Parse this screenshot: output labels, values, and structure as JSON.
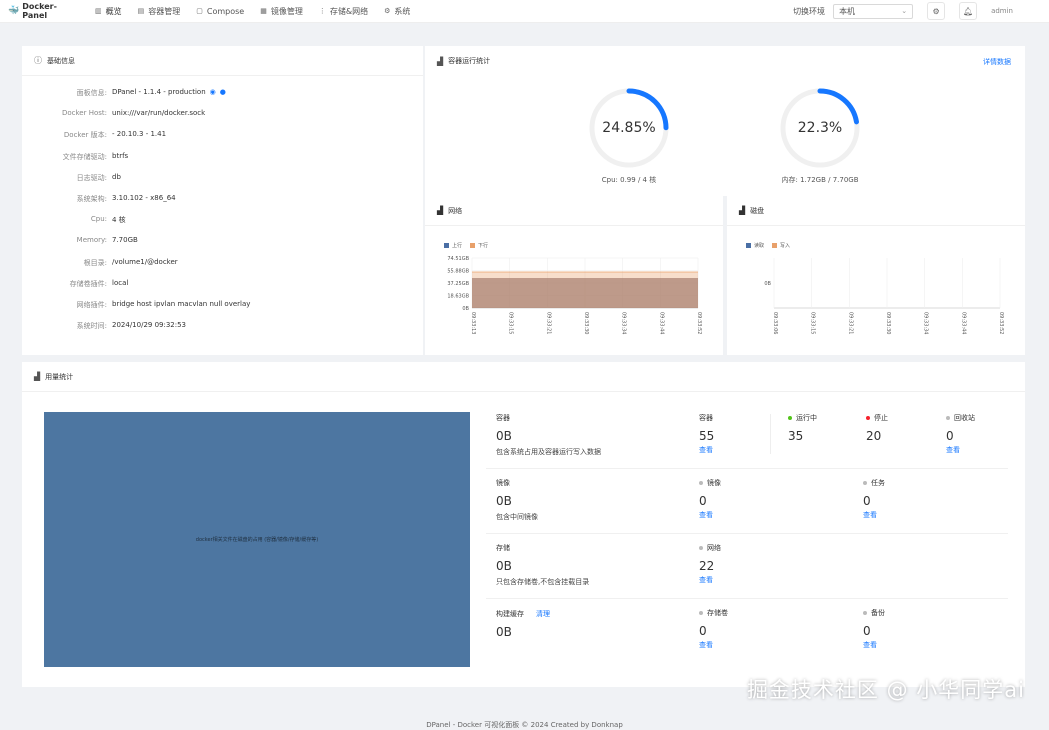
{
  "app": {
    "name": "Docker-Panel"
  },
  "nav": [
    {
      "icon": "chart-bar-icon",
      "glyph": "▥",
      "label": "概览"
    },
    {
      "icon": "container-icon",
      "glyph": "▤",
      "label": "容器管理"
    },
    {
      "icon": "compose-icon",
      "glyph": "▢",
      "label": "Compose"
    },
    {
      "icon": "image-icon",
      "glyph": "▦",
      "label": "镜像管理"
    },
    {
      "icon": "storage-icon",
      "glyph": "⋮",
      "label": "存储&网络"
    },
    {
      "icon": "gear-icon",
      "glyph": "⚙",
      "label": "系统"
    }
  ],
  "header": {
    "env_label": "切换环境",
    "env_value": "本机",
    "user": "admin"
  },
  "info_card": {
    "title": "基础信息",
    "rows": [
      {
        "label": "面板信息:",
        "value": "DPanel - 1.1.4 - production"
      },
      {
        "label": "Docker Host:",
        "value": "unix:///var/run/docker.sock"
      },
      {
        "label": "Docker 版本:",
        "value": "- 20.10.3 - 1.41"
      },
      {
        "label": "文件存储驱动:",
        "value": "btrfs"
      },
      {
        "label": "日志驱动:",
        "value": "db"
      },
      {
        "label": "系统架构:",
        "value": "3.10.102 - x86_64"
      },
      {
        "label": "Cpu:",
        "value": "4 核"
      },
      {
        "label": "Memory:",
        "value": "7.70GB"
      },
      {
        "label": "根目录:",
        "value": "/volume1/@docker"
      },
      {
        "label": "存储卷插件:",
        "value": "local"
      },
      {
        "label": "网络插件:",
        "value": "bridge  host  ipvlan  macvlan  null  overlay"
      },
      {
        "label": "系统时间:",
        "value": "2024/10/29 09:32:53"
      }
    ]
  },
  "stats_card": {
    "title": "容器运行统计",
    "detail_link": "详情数据",
    "cpu": {
      "percent": 24.85,
      "text": "24.85%",
      "caption": "Cpu: 0.99 / 4 核"
    },
    "mem": {
      "percent": 22.3,
      "text": "22.3%",
      "caption": "内存: 1.72GB / 7.70GB"
    }
  },
  "network": {
    "title": "网络",
    "legend": [
      {
        "name": "上行",
        "color": "#4a6fa5"
      },
      {
        "name": "下行",
        "color": "#e8a06a"
      }
    ],
    "y_ticks": [
      "74.51GB",
      "55.88GB",
      "37.25GB",
      "18.63GB",
      "0B"
    ],
    "x_ticks": [
      "09:33:13",
      "09:33:15",
      "09:33:21",
      "09:33:30",
      "09:33:34",
      "09:33:44",
      "09:33:52"
    ]
  },
  "disk": {
    "title": "磁盘",
    "legend": [
      {
        "name": "读取",
        "color": "#4a6fa5"
      },
      {
        "name": "写入",
        "color": "#e8a06a"
      }
    ],
    "y_ticks": [
      "0B"
    ],
    "x_ticks": [
      "09:33:06",
      "09:33:15",
      "09:33:21",
      "09:33:30",
      "09:33:34",
      "09:33:44",
      "09:33:52"
    ]
  },
  "usage": {
    "title": "用量统计",
    "treemap_caption": "docker相关文件在磁盘的占用 (容器/镜像/存储/缓存等)",
    "container": {
      "title": "容器",
      "size": "0B",
      "desc": "包含系统占用及容器运行写入数据"
    },
    "image": {
      "title": "镜像",
      "size": "0B",
      "desc": "包含中间镜像"
    },
    "storage": {
      "title": "存储",
      "size": "0B",
      "desc": "只包含存储卷,不包含挂载目录"
    },
    "build": {
      "title": "构建缓存",
      "action": "清理",
      "size": "0B"
    },
    "counts": {
      "containers": {
        "label": "容器",
        "value": "55",
        "link": "查看"
      },
      "running": {
        "label": "运行中",
        "value": "35"
      },
      "stopped": {
        "label": "停止",
        "value": "20"
      },
      "recycle": {
        "label": "回收站",
        "value": "0",
        "link": "查看"
      },
      "images": {
        "label": "镜像",
        "value": "0",
        "link": "查看"
      },
      "tasks": {
        "label": "任务",
        "value": "0",
        "link": "查看"
      },
      "networks": {
        "label": "网络",
        "value": "22",
        "link": "查看"
      },
      "volumes": {
        "label": "存储卷",
        "value": "0",
        "link": "查看"
      },
      "backups": {
        "label": "备份",
        "value": "0",
        "link": "查看"
      }
    }
  },
  "footer": "DPanel - Docker 可视化面板 © 2024 Created by Donknap",
  "watermark": "掘金技术社区 @ 小华同学ai",
  "colors": {
    "accent": "#1677ff",
    "treemap": "#4d76a1",
    "running": "#52c41a",
    "stopped": "#f5222d"
  }
}
